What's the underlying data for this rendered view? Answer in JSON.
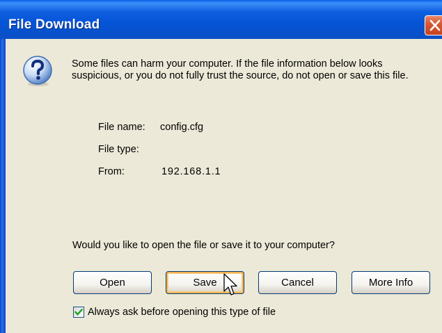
{
  "window": {
    "title": "File Download",
    "close_icon": "close-icon"
  },
  "message": {
    "icon": "question-icon",
    "text": "Some files can harm your computer. If the file information below looks suspicious, or you do not fully trust the source, do not open or save this file."
  },
  "file_info": {
    "name_label": "File name:",
    "name_value": "config.cfg",
    "type_label": "File type:",
    "type_value": "",
    "from_label": "From:",
    "from_value": "192.168.1.1"
  },
  "question": "Would you like to open the file or save it to your computer?",
  "buttons": {
    "open": "Open",
    "save": "Save",
    "cancel": "Cancel",
    "more_info": "More Info"
  },
  "checkbox": {
    "label": "Always ask before opening this type of file",
    "checked": true
  },
  "colors": {
    "titlebar": "#0554d6",
    "dialog_bg": "#ece9d8",
    "close_button": "#d65a35",
    "button_border": "#003c74",
    "focus_ring": "#f8b352",
    "checkmark": "#21a121"
  }
}
